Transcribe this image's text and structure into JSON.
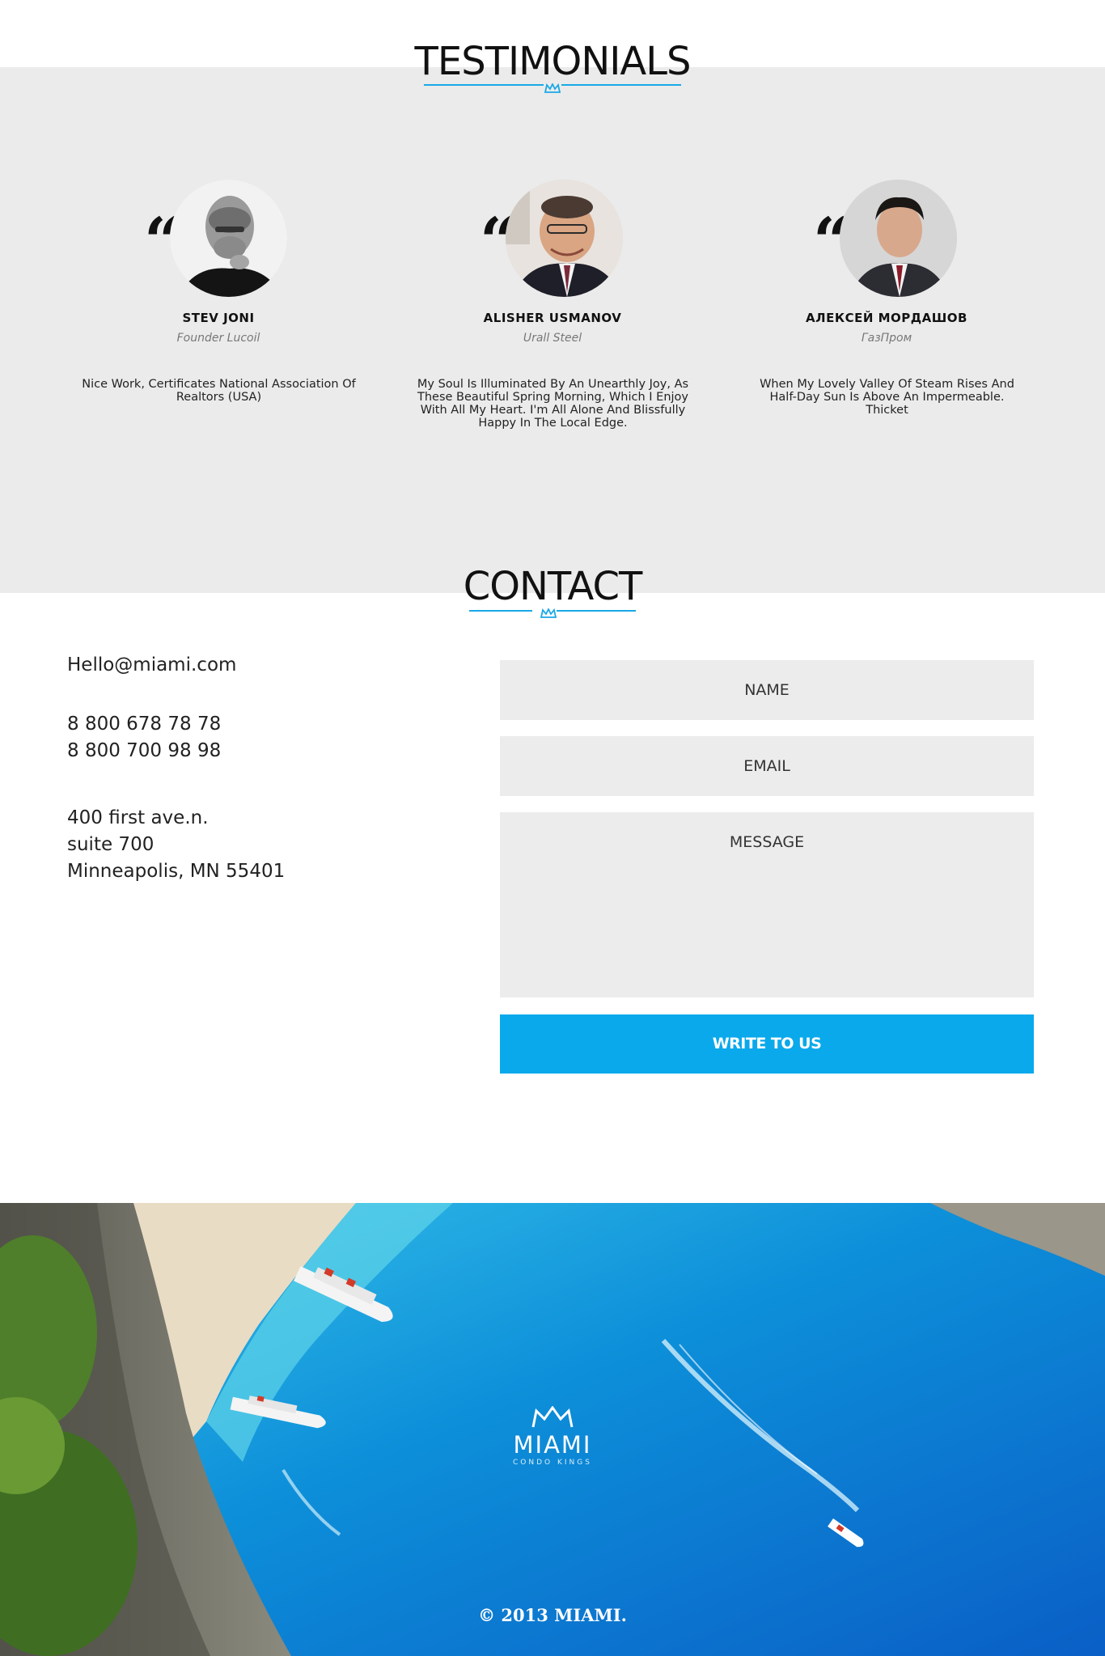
{
  "testimonials": {
    "title": "TESTIMONIALS",
    "items": [
      {
        "name": "STEV JONI",
        "role": "Founder Lucoil",
        "text": "Nice Work, Certificates National Association Of Realtors (USA)"
      },
      {
        "name": "ALISHER USMANOV",
        "role": "Urall Steel",
        "text": "My Soul Is Illuminated By An Unearthly Joy, As These Beautiful Spring Morning, Which I Enjoy With All My Heart. I'm All Alone And Blissfully Happy In The Local Edge."
      },
      {
        "name": "АЛЕКСЕЙ МОРДАШОВ",
        "role": "ГазПром",
        "text": "When My Lovely Valley Of Steam Rises And Half-Day Sun Is Above An Impermeable. Thicket"
      }
    ]
  },
  "contact": {
    "title": "CONTACT",
    "email": "Hello@miami.com",
    "phones": [
      "8 800 678 78 78",
      "8 800 700 98 98"
    ],
    "address": [
      "400 first ave.n.",
      "suite 700",
      "Minneapolis, MN 55401"
    ],
    "form": {
      "name_placeholder": "NAME",
      "email_placeholder": "EMAIL",
      "message_placeholder": "MESSAGE",
      "submit_label": "WRITE TO US"
    }
  },
  "footer": {
    "logo_word": "MIAMI",
    "logo_sub": "CONDO KINGS",
    "copyright": "© 2013 MIAMI."
  },
  "colors": {
    "accent": "#0aa9ec",
    "band": "#ebebeb",
    "field": "#ececec"
  }
}
